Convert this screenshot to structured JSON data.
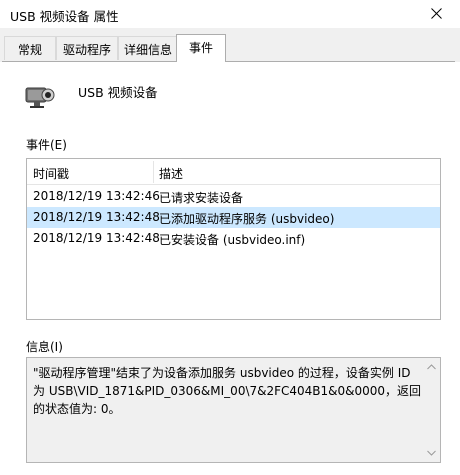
{
  "window": {
    "title": "USB 视频设备 属性"
  },
  "tabs": [
    {
      "label": "常规"
    },
    {
      "label": "驱动程序"
    },
    {
      "label": "详细信息"
    },
    {
      "label": "事件",
      "active": true
    }
  ],
  "device": {
    "name": "USB 视频设备",
    "icon": "webcam-icon"
  },
  "events_label": "事件(E)",
  "events_table": {
    "columns": [
      "时间戳",
      "描述"
    ],
    "rows": [
      {
        "timestamp": "2018/12/19 13:42:46",
        "description": "已请求安装设备",
        "selected": false
      },
      {
        "timestamp": "2018/12/19 13:42:48",
        "description": "已添加驱动程序服务 (usbvideo)",
        "selected": true
      },
      {
        "timestamp": "2018/12/19 13:42:48",
        "description": "已安装设备 (usbvideo.inf)",
        "selected": false
      }
    ]
  },
  "info_label": "信息(I)",
  "info_text": "\"驱动程序管理\"结束了为设备添加服务 usbvideo 的过程，设备实例 ID 为 USB\\VID_1871&PID_0306&MI_00\\7&2FC404B1&0&0000，返回的状态值为: 0。",
  "colors": {
    "selection": "#cce8ff",
    "window_bg": "#ffffff",
    "tab_bg": "#f0f0f0"
  }
}
